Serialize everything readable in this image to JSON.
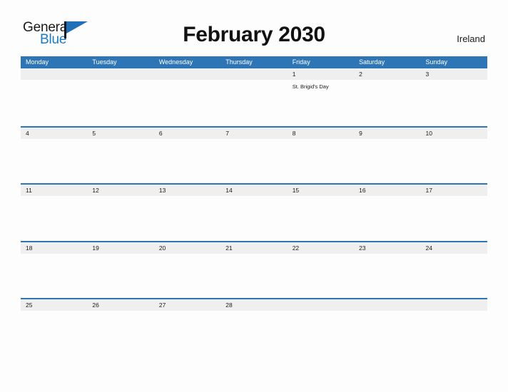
{
  "brand": {
    "name_primary": "General",
    "name_secondary": "Blue",
    "primary_color": "#1a1a1a",
    "secondary_color": "#1f7ac0",
    "flag_icon": "flag-triangle-icon"
  },
  "header": {
    "title": "February 2030",
    "country": "Ireland"
  },
  "colors": {
    "header_blue": "#2e75b6",
    "date_band_gray": "#efefef",
    "page_background": "#fdfdfd",
    "text": "#1a1a1a"
  },
  "calendar": {
    "month": "February",
    "year": "2030",
    "weekdays": [
      "Monday",
      "Tuesday",
      "Wednesday",
      "Thursday",
      "Friday",
      "Saturday",
      "Sunday"
    ],
    "weeks": [
      {
        "days": [
          {
            "date": "",
            "event": ""
          },
          {
            "date": "",
            "event": ""
          },
          {
            "date": "",
            "event": ""
          },
          {
            "date": "",
            "event": ""
          },
          {
            "date": "1",
            "event": "St. Brigid's Day"
          },
          {
            "date": "2",
            "event": ""
          },
          {
            "date": "3",
            "event": ""
          }
        ]
      },
      {
        "days": [
          {
            "date": "4",
            "event": ""
          },
          {
            "date": "5",
            "event": ""
          },
          {
            "date": "6",
            "event": ""
          },
          {
            "date": "7",
            "event": ""
          },
          {
            "date": "8",
            "event": ""
          },
          {
            "date": "9",
            "event": ""
          },
          {
            "date": "10",
            "event": ""
          }
        ]
      },
      {
        "days": [
          {
            "date": "11",
            "event": ""
          },
          {
            "date": "12",
            "event": ""
          },
          {
            "date": "13",
            "event": ""
          },
          {
            "date": "14",
            "event": ""
          },
          {
            "date": "15",
            "event": ""
          },
          {
            "date": "16",
            "event": ""
          },
          {
            "date": "17",
            "event": ""
          }
        ]
      },
      {
        "days": [
          {
            "date": "18",
            "event": ""
          },
          {
            "date": "19",
            "event": ""
          },
          {
            "date": "20",
            "event": ""
          },
          {
            "date": "21",
            "event": ""
          },
          {
            "date": "22",
            "event": ""
          },
          {
            "date": "23",
            "event": ""
          },
          {
            "date": "24",
            "event": ""
          }
        ]
      },
      {
        "days": [
          {
            "date": "25",
            "event": ""
          },
          {
            "date": "26",
            "event": ""
          },
          {
            "date": "27",
            "event": ""
          },
          {
            "date": "28",
            "event": ""
          },
          {
            "date": "",
            "event": ""
          },
          {
            "date": "",
            "event": ""
          },
          {
            "date": "",
            "event": ""
          }
        ]
      }
    ]
  }
}
